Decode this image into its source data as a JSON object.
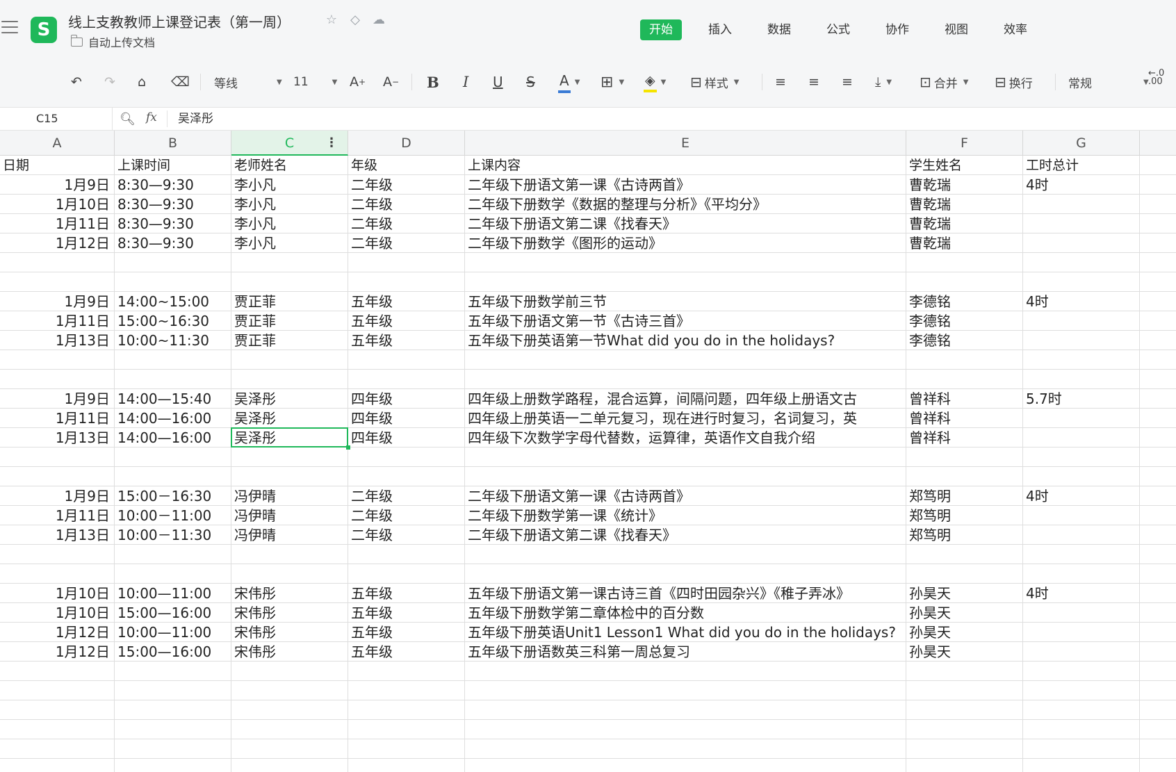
{
  "app": {
    "title": "线上支教教师上课登记表（第一周）",
    "subtitle": "自动上传文档",
    "logo_letter": "S",
    "menu_tabs": [
      "开始",
      "插入",
      "数据",
      "公式",
      "协作",
      "视图",
      "效率"
    ],
    "active_tab": "开始"
  },
  "toolbar": {
    "font_name": "等线",
    "font_size": "11",
    "style_label": "样式",
    "merge_label": "合并",
    "wrap_label": "换行",
    "number_format": "常规"
  },
  "formula_bar": {
    "cell_ref": "C15",
    "value": "吴泽彤"
  },
  "sheet": {
    "columns": [
      "A",
      "B",
      "C",
      "D",
      "E",
      "F",
      "G"
    ],
    "selected_column": "C",
    "header": [
      "日期",
      "上课时间",
      "老师姓名",
      "年级",
      "上课内容",
      "学生姓名",
      "工时总计"
    ],
    "rows": [
      [
        "1月9日",
        "8:30—9:30",
        "李小凡",
        "二年级",
        "二年级下册语文第一课《古诗两首》",
        "曹乾瑞",
        "4时"
      ],
      [
        "1月10日",
        "8:30—9:30",
        "李小凡",
        "二年级",
        "二年级下册数学《数据的整理与分析》《平均分》",
        "曹乾瑞",
        ""
      ],
      [
        "1月11日",
        "8:30—9:30",
        "李小凡",
        "二年级",
        "二年级下册语文第二课《找春天》",
        "曹乾瑞",
        ""
      ],
      [
        "1月12日",
        "8:30—9:30",
        "李小凡",
        "二年级",
        "二年级下册数学《图形的运动》",
        "曹乾瑞",
        ""
      ],
      [
        "",
        "",
        "",
        "",
        "",
        "",
        ""
      ],
      [
        "",
        "",
        "",
        "",
        "",
        "",
        ""
      ],
      [
        "1月9日",
        "14:00~15:00",
        "贾正菲",
        "五年级",
        "五年级下册数学前三节",
        "李德铭",
        "4时"
      ],
      [
        "1月11日",
        "15:00~16:30",
        "贾正菲",
        "五年级",
        "五年级下册语文第一节《古诗三首》",
        "李德铭",
        ""
      ],
      [
        "1月13日",
        "10:00~11:30",
        "贾正菲",
        "五年级",
        "五年级下册英语第一节What did you do in the holidays?",
        "李德铭",
        ""
      ],
      [
        "",
        "",
        "",
        "",
        "",
        "",
        ""
      ],
      [
        "",
        "",
        "",
        "",
        "",
        "",
        ""
      ],
      [
        "1月9日",
        "14:00—15:40",
        "吴泽彤",
        "四年级",
        "四年级上册数学路程，混合运算，间隔问题，四年级上册语文古",
        "曾祥科",
        "5.7时"
      ],
      [
        "1月11日",
        "14:00—16:00",
        "吴泽彤",
        "四年级",
        "四年级上册英语一二单元复习，现在进行时复习，名词复习，英",
        "曾祥科",
        ""
      ],
      [
        "1月13日",
        "14:00—16:00",
        "吴泽彤",
        "四年级",
        "四年级下次数学字母代替数，运算律，英语作文自我介绍",
        "曾祥科",
        ""
      ],
      [
        "",
        "",
        "",
        "",
        "",
        "",
        ""
      ],
      [
        "",
        "",
        "",
        "",
        "",
        "",
        ""
      ],
      [
        "1月9日",
        "15:00－16:30",
        "冯伊晴",
        "二年级",
        "二年级下册语文第一课《古诗两首》",
        "郑笃明",
        "4时"
      ],
      [
        "1月11日",
        "10:00－11:00",
        "冯伊晴",
        "二年级",
        "二年级下册数学第一课《统计》",
        "郑笃明",
        ""
      ],
      [
        "1月13日",
        "10:00－11:30",
        "冯伊晴",
        "二年级",
        "二年级下册语文第二课《找春天》",
        "郑笃明",
        ""
      ],
      [
        "",
        "",
        "",
        "",
        "",
        "",
        ""
      ],
      [
        "",
        "",
        "",
        "",
        "",
        "",
        ""
      ],
      [
        "1月10日",
        "10:00—11:00",
        "宋伟彤",
        "五年级",
        "五年级下册语文第一课古诗三首《四时田园杂兴》《稚子弄冰》",
        "孙昊天",
        "4时"
      ],
      [
        "1月10日",
        "15:00—16:00",
        "宋伟彤",
        "五年级",
        "五年级下册数学第二章体检中的百分数",
        "孙昊天",
        ""
      ],
      [
        "1月12日",
        "10:00—11:00",
        "宋伟彤",
        "五年级",
        "五年级下册英语Unit1 Lesson1 What did you do in the holidays?",
        "孙昊天",
        ""
      ],
      [
        "1月12日",
        "15:00—16:00",
        "宋伟彤",
        "五年级",
        "五年级下册语数英三科第一周总复习",
        "孙昊天",
        ""
      ],
      [
        "",
        "",
        "",
        "",
        "",
        "",
        ""
      ],
      [
        "",
        "",
        "",
        "",
        "",
        "",
        ""
      ],
      [
        "",
        "",
        "",
        "",
        "",
        "",
        ""
      ],
      [
        "",
        "",
        "",
        "",
        "",
        "",
        ""
      ],
      [
        "",
        "",
        "",
        "",
        "",
        "",
        ""
      ],
      [
        "",
        "",
        "",
        "",
        "",
        "",
        ""
      ]
    ]
  }
}
